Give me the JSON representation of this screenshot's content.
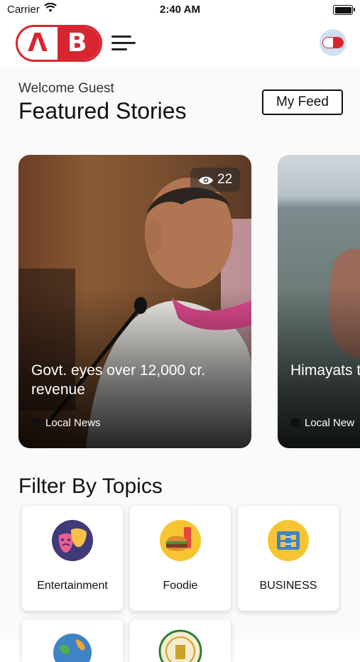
{
  "status_bar": {
    "carrier": "Carrier",
    "time": "2:40 AM"
  },
  "header": {
    "logo": {
      "letter_a": "Λ",
      "letter_b": "B",
      "brand_color": "#d7262f"
    },
    "menu_icon": "hamburger-menu-icon",
    "avatar_icon": "profile-avatar-icon"
  },
  "main": {
    "welcome": "Welcome Guest",
    "section_title": "Featured Stories",
    "my_feed_label": "My Feed",
    "stories": [
      {
        "views": "22",
        "title": "Govt. eyes over 12,000 cr. revenue",
        "category": "Local News"
      },
      {
        "title": "Himayats to let out",
        "category": "Local New"
      }
    ],
    "filter_title": "Filter By Topics",
    "topics": [
      {
        "label": "Entertainment",
        "icon": "theater-masks-icon"
      },
      {
        "label": "Foodie",
        "icon": "burger-icon"
      },
      {
        "label": "BUSINESS",
        "icon": "business-network-icon"
      }
    ],
    "topics_row2_icons": [
      "globe-icon",
      "state-emblem-icon"
    ]
  }
}
